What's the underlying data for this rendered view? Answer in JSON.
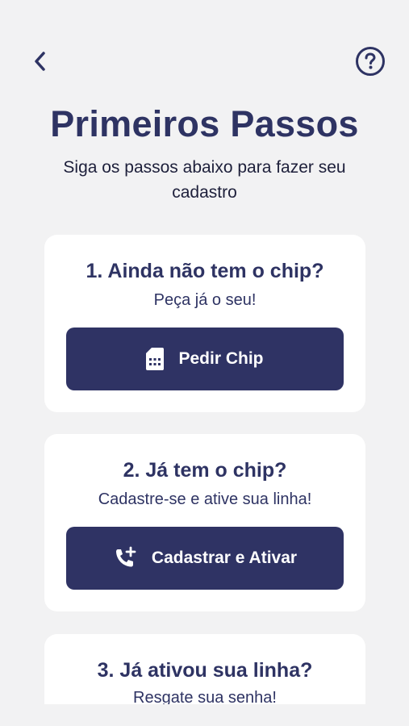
{
  "header": {
    "back_icon": "chevron-left-icon",
    "help_icon": "question-circle-icon"
  },
  "page": {
    "title": "Primeiros Passos",
    "subtitle": "Siga os passos abaixo para fazer seu cadastro"
  },
  "steps": [
    {
      "title": "1. Ainda não tem o chip?",
      "description": "Peça já o seu!",
      "button_label": "Pedir Chip",
      "button_icon": "sim-card-icon"
    },
    {
      "title": "2. Já tem o chip?",
      "description": "Cadastre-se e ative sua linha!",
      "button_label": "Cadastrar e Ativar",
      "button_icon": "phone-add-icon"
    },
    {
      "title": "3. Já ativou sua linha?",
      "description": "Resgate sua senha!"
    }
  ],
  "colors": {
    "primary": "#2f3364",
    "background": "#f2f2f3",
    "card": "#ffffff"
  }
}
